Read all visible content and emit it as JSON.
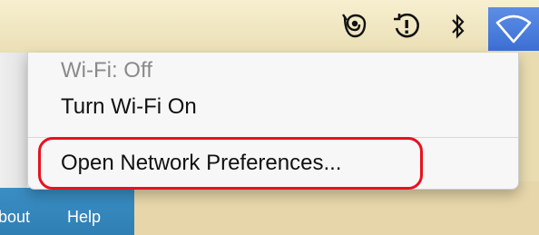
{
  "menubar": {
    "icons": [
      "scope-icon",
      "time-machine-icon",
      "bluetooth-icon",
      "wifi-icon"
    ],
    "wifi_active_color": "#4a7fe0"
  },
  "menu": {
    "status": "Wi-Fi: Off",
    "turn_on_label": "Turn Wi-Fi On",
    "open_prefs_label": "Open Network Preferences..."
  },
  "background": {
    "tabs": [
      "bout",
      "Help"
    ],
    "tab_color": "#3a8ec3"
  },
  "highlight_color": "#e8121c"
}
